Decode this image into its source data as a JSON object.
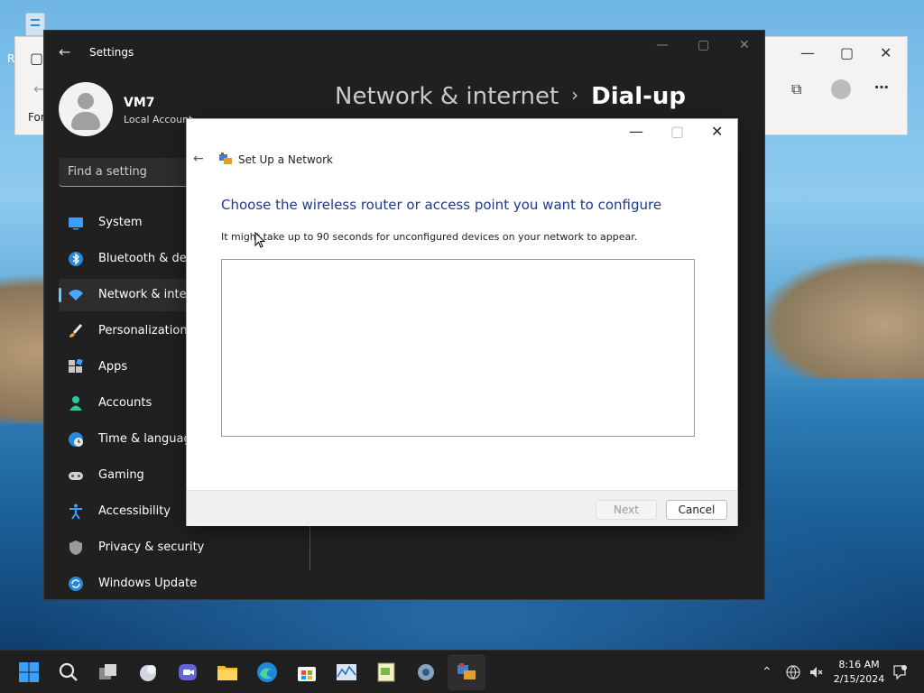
{
  "settings": {
    "app_title": "Settings",
    "user": {
      "name": "VM7",
      "account_type": "Local Account"
    },
    "search_placeholder": "Find a setting",
    "breadcrumb": {
      "parent": "Network & internet",
      "separator": "›",
      "current": "Dial-up"
    },
    "nav": [
      {
        "label": "System",
        "icon": "monitor-icon"
      },
      {
        "label": "Bluetooth & dev",
        "icon": "bluetooth-icon"
      },
      {
        "label": "Network & inter",
        "icon": "wifi-icon",
        "active": true
      },
      {
        "label": "Personalization",
        "icon": "brush-icon"
      },
      {
        "label": "Apps",
        "icon": "apps-icon"
      },
      {
        "label": "Accounts",
        "icon": "person-icon"
      },
      {
        "label": "Time & languag",
        "icon": "globe-clock-icon"
      },
      {
        "label": "Gaming",
        "icon": "gamepad-icon"
      },
      {
        "label": "Accessibility",
        "icon": "accessibility-icon"
      },
      {
        "label": "Privacy & security",
        "icon": "shield-icon"
      },
      {
        "label": "Windows Update",
        "icon": "update-icon"
      }
    ]
  },
  "background_window": {
    "left_text": "For",
    "left_text2": "R"
  },
  "dialog": {
    "title": "Set Up a Network",
    "prompt": "Choose the wireless router or access point you want to configure",
    "hint": "It might take up to 90 seconds for unconfigured devices on your network to appear.",
    "next_label": "Next",
    "cancel_label": "Cancel"
  },
  "taskbar": {
    "time": "8:16 AM",
    "date": "2/15/2024"
  },
  "colors": {
    "accent": "#60cdff",
    "prompt_blue": "#1b3a8a",
    "settings_bg": "#202020"
  }
}
